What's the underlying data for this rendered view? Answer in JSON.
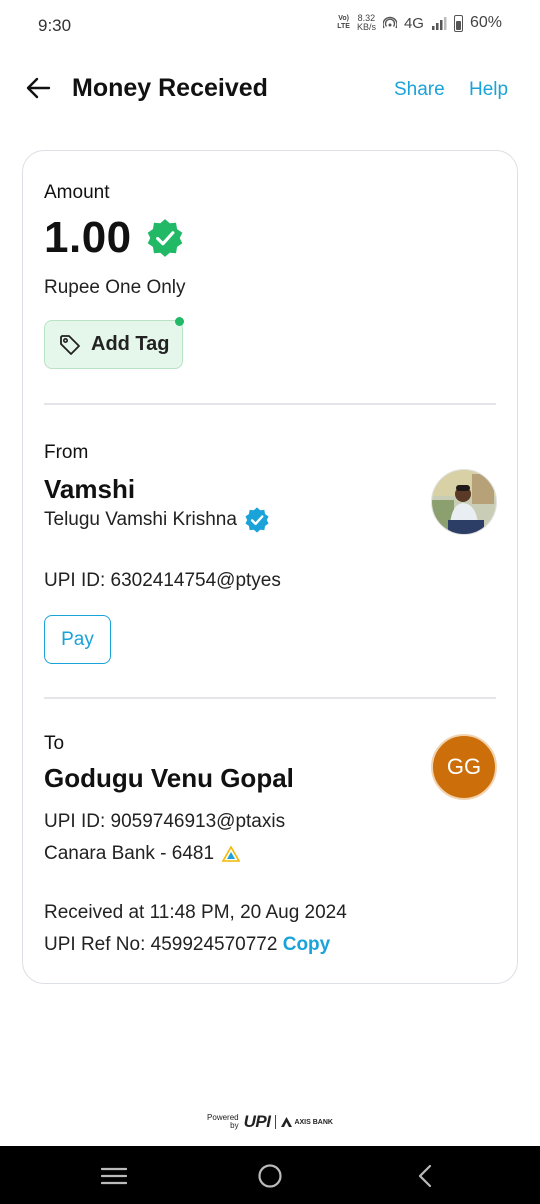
{
  "status_bar": {
    "time": "9:30",
    "volte_top": "Vo)",
    "volte_bottom": "LTE",
    "speed_value": "8.32",
    "speed_unit": "KB/s",
    "network": "4G",
    "battery": "60%"
  },
  "header": {
    "title": "Money Received",
    "share_label": "Share",
    "help_label": "Help"
  },
  "amount": {
    "label": "Amount",
    "value": "1.00",
    "words": "Rupee One Only",
    "add_tag_label": "Add Tag"
  },
  "from": {
    "label": "From",
    "name": "Vamshi",
    "full_name": "Telugu Vamshi Krishna",
    "upi_id": "UPI ID: 6302414754@ptyes",
    "pay_label": "Pay"
  },
  "to": {
    "label": "To",
    "name": "Godugu Venu Gopal",
    "avatar_initials": "GG",
    "upi_id": "UPI ID: 9059746913@ptaxis",
    "bank": "Canara Bank - 6481",
    "received_at": "Received at 11:48 PM, 20 Aug 2024",
    "ref_no": "UPI Ref No: 459924570772",
    "copy_label": "Copy"
  },
  "footer": {
    "powered_line1": "Powered",
    "powered_line2": "by",
    "upi_text": "UPI",
    "partner_bank": "AXIS BANK"
  },
  "colors": {
    "accent": "#1aa3d9",
    "verified_green": "#21b866",
    "verified_blue": "#1aa3d9",
    "tag_bg": "#e5f6ea",
    "avatar_orange": "#cc6f0b"
  },
  "icons": {
    "back": "arrow-left-icon",
    "tag": "tag-icon",
    "verified": "verified-badge-icon",
    "bank": "bank-logo-icon"
  }
}
